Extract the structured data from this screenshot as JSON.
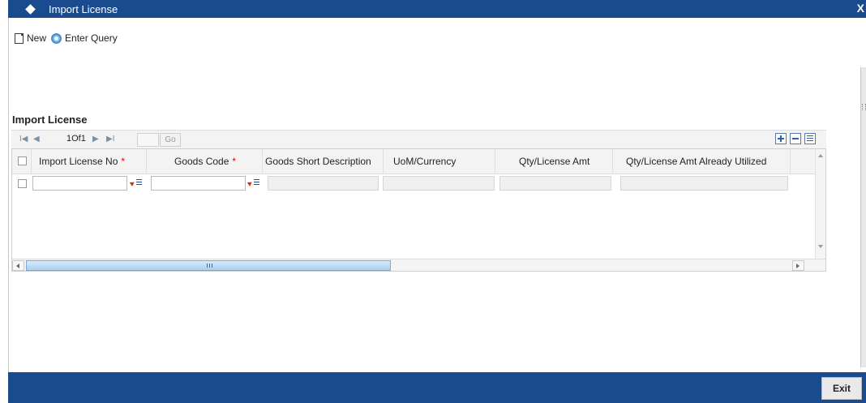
{
  "window": {
    "title": "Import License",
    "close_label": "X"
  },
  "toolbar": {
    "new_label": "New",
    "enter_query_label": "Enter Query"
  },
  "section": {
    "title": "Import License"
  },
  "pagination": {
    "page_info": "1Of1",
    "page_value": "",
    "go_label": "Go"
  },
  "table": {
    "columns": [
      {
        "label": "Import License No",
        "required": true
      },
      {
        "label": "Goods Code",
        "required": true
      },
      {
        "label": "Goods Short Description",
        "required": false
      },
      {
        "label": "UoM/Currency",
        "required": false
      },
      {
        "label": "Qty/License Amt",
        "required": false
      },
      {
        "label": "Qty/License Amt Already Utilized",
        "required": false
      }
    ],
    "required_marker": "*",
    "rows": [
      {
        "import_license_no": "",
        "goods_code": "",
        "goods_short_description": "",
        "uom_currency": "",
        "qty_license_amt": "",
        "qty_license_amt_utilized": ""
      }
    ]
  },
  "footer": {
    "exit_label": "Exit"
  },
  "colors": {
    "titlebar": "#1b4b8f",
    "footer": "#1b4b8f",
    "required": "#dd0000"
  }
}
